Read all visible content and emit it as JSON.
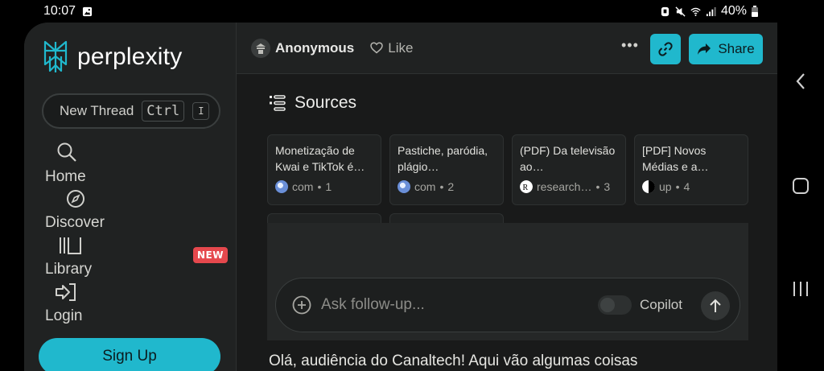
{
  "statusbar": {
    "time": "10:07",
    "battery": "40%"
  },
  "sidebar": {
    "logo": "perplexity",
    "new_thread": {
      "label": "New Thread",
      "kbd1": "Ctrl",
      "kbd2": "I"
    },
    "items": [
      {
        "label": "Home",
        "icon": "search-icon"
      },
      {
        "label": "Discover",
        "icon": "compass-icon"
      },
      {
        "label": "Library",
        "icon": "library-icon",
        "badge": "NEW"
      },
      {
        "label": "Login",
        "icon": "login-icon"
      }
    ],
    "signup": "Sign Up"
  },
  "topbar": {
    "author": "Anonymous",
    "like": "Like",
    "share": "Share"
  },
  "sources": {
    "heading": "Sources",
    "cards": [
      {
        "title": "Monetização de Kwai e TikTok é…",
        "site": "com",
        "index": "1"
      },
      {
        "title": "Pastiche, paródia, plágio…",
        "site": "com",
        "index": "2"
      },
      {
        "title": "(PDF) Da televisão ao…",
        "site": "research…",
        "index": "3"
      },
      {
        "title": "[PDF] Novos Médias e a…",
        "site": "up",
        "index": "4"
      }
    ]
  },
  "followup": {
    "placeholder": "Ask follow-up...",
    "copilot": "Copilot"
  },
  "answer": {
    "text": "Olá, audiência do Canaltech! Aqui vão algumas coisas"
  },
  "colors": {
    "accent": "#20b8cd",
    "badge": "#e5484d",
    "background": "#191a1a"
  }
}
